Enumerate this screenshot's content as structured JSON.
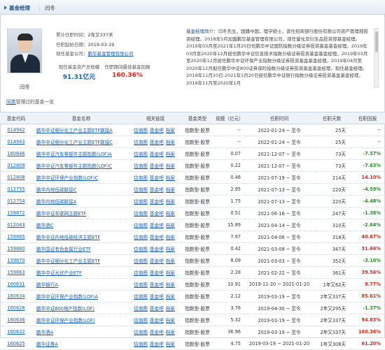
{
  "header": {
    "label": "基金经理",
    "sep": "：",
    "name": "闫冬"
  },
  "manager": {
    "photo_alt": "manager-photo",
    "name": "闫冬",
    "cumulative_tenure_label": "累计任职时间：",
    "cumulative_tenure": "2年又337天",
    "start_date_label": "任职起始日期：",
    "start_date": "2019-03-19",
    "company_label": "现任基金公司：",
    "company": "鹏华基金管理有限公司",
    "aum_label": "现任基金资产总规模",
    "aum_value": "91.31亿元",
    "best_return_label": "任职期间最佳基金回报",
    "best_return_value": "160.36%"
  },
  "bio": {
    "label": "基金经理简介：",
    "text": "闫冬先生，国籍中国，理学硕士，曾任招商银行股份有限公司资产管理部投资经理。2018年5月加盟鹏华基金管理有限公司，现任量化及衍生品投资部基金经理。2019年03月至2021年1月20日任鹏华中证国防指数分级证券投资基金基金经理。2019年03月至2020年12月担任鹏华中证信息技术指数分级证券投资基金基金经理。2019年03月至2020年12月担任鹏华中证环保产业指数分级证券投资基金基金经理。2019年04月至2020年12月担任鹏华中证800证券保险指数分级证券投资基金基金经理，现任基金经理。2019年11月20日-2021年1月20日担任鹏华中证银行指数分级证券投资基金基金经理，2019年11月至2020年1月"
  },
  "table_title": {
    "link": "同类",
    "rest": "管理过的基金一览"
  },
  "table": {
    "columns": [
      "基金代码",
      "基金名称",
      "相关链接",
      "基金类型",
      "规模（亿元）",
      "任职时间",
      "任职天数",
      "任职回报"
    ],
    "ops": [
      "估值图",
      "基金吧",
      "档案"
    ],
    "rows": [
      {
        "code": "014942",
        "name": "鹏华中证细分化工产业主题ETF联接A",
        "type": "指数型-股票",
        "size": "--",
        "period": "2022-01-24 ~ 至今",
        "days": "25天",
        "ret": "--",
        "dir": "none"
      },
      {
        "code": "014943",
        "name": "鹏华中证细分化工产业主题ETF联接C",
        "type": "指数型-股票",
        "size": "--",
        "period": "2022-01-24 ~ 至今",
        "days": "25天",
        "ret": "--",
        "dir": "none"
      },
      {
        "code": "160646",
        "name": "鹏华中证汽车零部件主题指数(LOF)A",
        "type": "指数型-股票",
        "size": "0.07",
        "period": "2021-12-07 ~ 至今",
        "days": "73天",
        "ret": "-7.57%",
        "dir": "neg"
      },
      {
        "code": "012809",
        "name": "鹏华中证汽车零部件主题指数(LOF)C",
        "type": "指数型-股票",
        "size": "0.22",
        "period": "2021-12-07 ~ 至今",
        "days": "73天",
        "ret": "-7.63%",
        "dir": "neg"
      },
      {
        "code": "012808",
        "name": "鹏华中证环保产业指数(LOF)C",
        "type": "指数型-股票",
        "size": "0.46",
        "period": "2021-07-19 ~ 至今",
        "days": "214天",
        "ret": "14.10%",
        "dir": "pos"
      },
      {
        "code": "012755",
        "name": "鹏华内地低碳联接C",
        "type": "指数型-股票",
        "size": "2.95",
        "period": "2021-07-13 ~ 至今",
        "days": "220天",
        "ret": "-4.59%",
        "dir": "neg"
      },
      {
        "code": "012754",
        "name": "鹏华内地低碳联接A",
        "type": "指数型-股票",
        "size": "1.75",
        "period": "2021-07-13 ~ 至今",
        "days": "220天",
        "ret": "-4.48%",
        "dir": "neg"
      },
      {
        "code": "159872",
        "name": "鹏华中证车联网主题ETF",
        "type": "指数型-股票",
        "size": "0.51",
        "period": "2021-06-16 ~ 至今",
        "days": "247天",
        "ret": "-1.38%",
        "dir": "neg"
      },
      {
        "code": "012043",
        "name": "鹏华酒C",
        "type": "指数型-股票",
        "size": "15.89",
        "period": "2021-04-14 ~ 至今",
        "days": "310天",
        "ret": "-2.64%",
        "dir": "neg"
      },
      {
        "code": "159885",
        "name": "鹏华中证内地低碳经济主题ETF",
        "type": "指数型-股票",
        "size": "7.97",
        "period": "2021-04-06 ~ 至今",
        "days": "318天",
        "ret": "40.67%",
        "dir": "pos"
      },
      {
        "code": "159880",
        "name": "鹏华国证有色金属行业ETF",
        "type": "指数型-股票",
        "size": "0.42",
        "period": "2021-03-08 ~ 至今",
        "days": "347天",
        "ret": "31.66%",
        "dir": "pos"
      },
      {
        "code": "159870",
        "name": "鹏华中证细分化工产业主题ETF",
        "type": "指数型-股票",
        "size": "8.09",
        "period": "2021-03-03 ~ 至今",
        "days": "352天",
        "ret": "-3.10%",
        "dir": "neg"
      },
      {
        "code": "159863",
        "name": "鹏华中证光伏产业ETF",
        "type": "指数型-股票",
        "size": "2.28",
        "period": "2021-02-22 ~ 至今",
        "days": "361天",
        "ret": "39.56%",
        "dir": "pos"
      },
      {
        "code": "160631",
        "name": "鹏华银行A",
        "type": "指数型-股票",
        "size": "10.91",
        "period": "2019-11-20 ~ 2021-01-20",
        "days": "1年又62天",
        "ret": "9.77%",
        "dir": "pos"
      },
      {
        "code": "160634",
        "name": "鹏华中证环保产业指数(LOF)A",
        "type": "指数型-股票",
        "size": "2.12",
        "period": "2019-03-19 ~ 至今",
        "days": "2年又337天",
        "ret": "85.61%",
        "dir": "pos"
      },
      {
        "code": "160628",
        "name": "鹏华中证800地产指数(LOF)",
        "type": "指数型-股票",
        "size": "3.76",
        "period": "2019-04-30 ~ 至今",
        "days": "2年又295天",
        "ret": "-1.37%",
        "dir": "neg"
      },
      {
        "code": "160636",
        "name": "鹏华中证环保产业指数(LOF)",
        "type": "指数型-股票",
        "size": "5.32",
        "period": "2019-03-19 ~ 至今",
        "days": "2年又337天",
        "ret": "94.83%",
        "dir": "pos"
      },
      {
        "code": "160632",
        "name": "鹏华酒A",
        "type": "指数型-股票",
        "size": "36.96",
        "period": "2019-03-19 ~ 至今",
        "days": "2年又337天",
        "ret": "160.36%",
        "dir": "pos"
      },
      {
        "code": "160625",
        "name": "鹏华证券A",
        "type": "指数型-股票",
        "size": "4.75",
        "period": "2019-03-19 ~ 2021-01-20",
        "days": "1年又308天",
        "ret": "61.20%",
        "dir": "pos"
      }
    ]
  }
}
